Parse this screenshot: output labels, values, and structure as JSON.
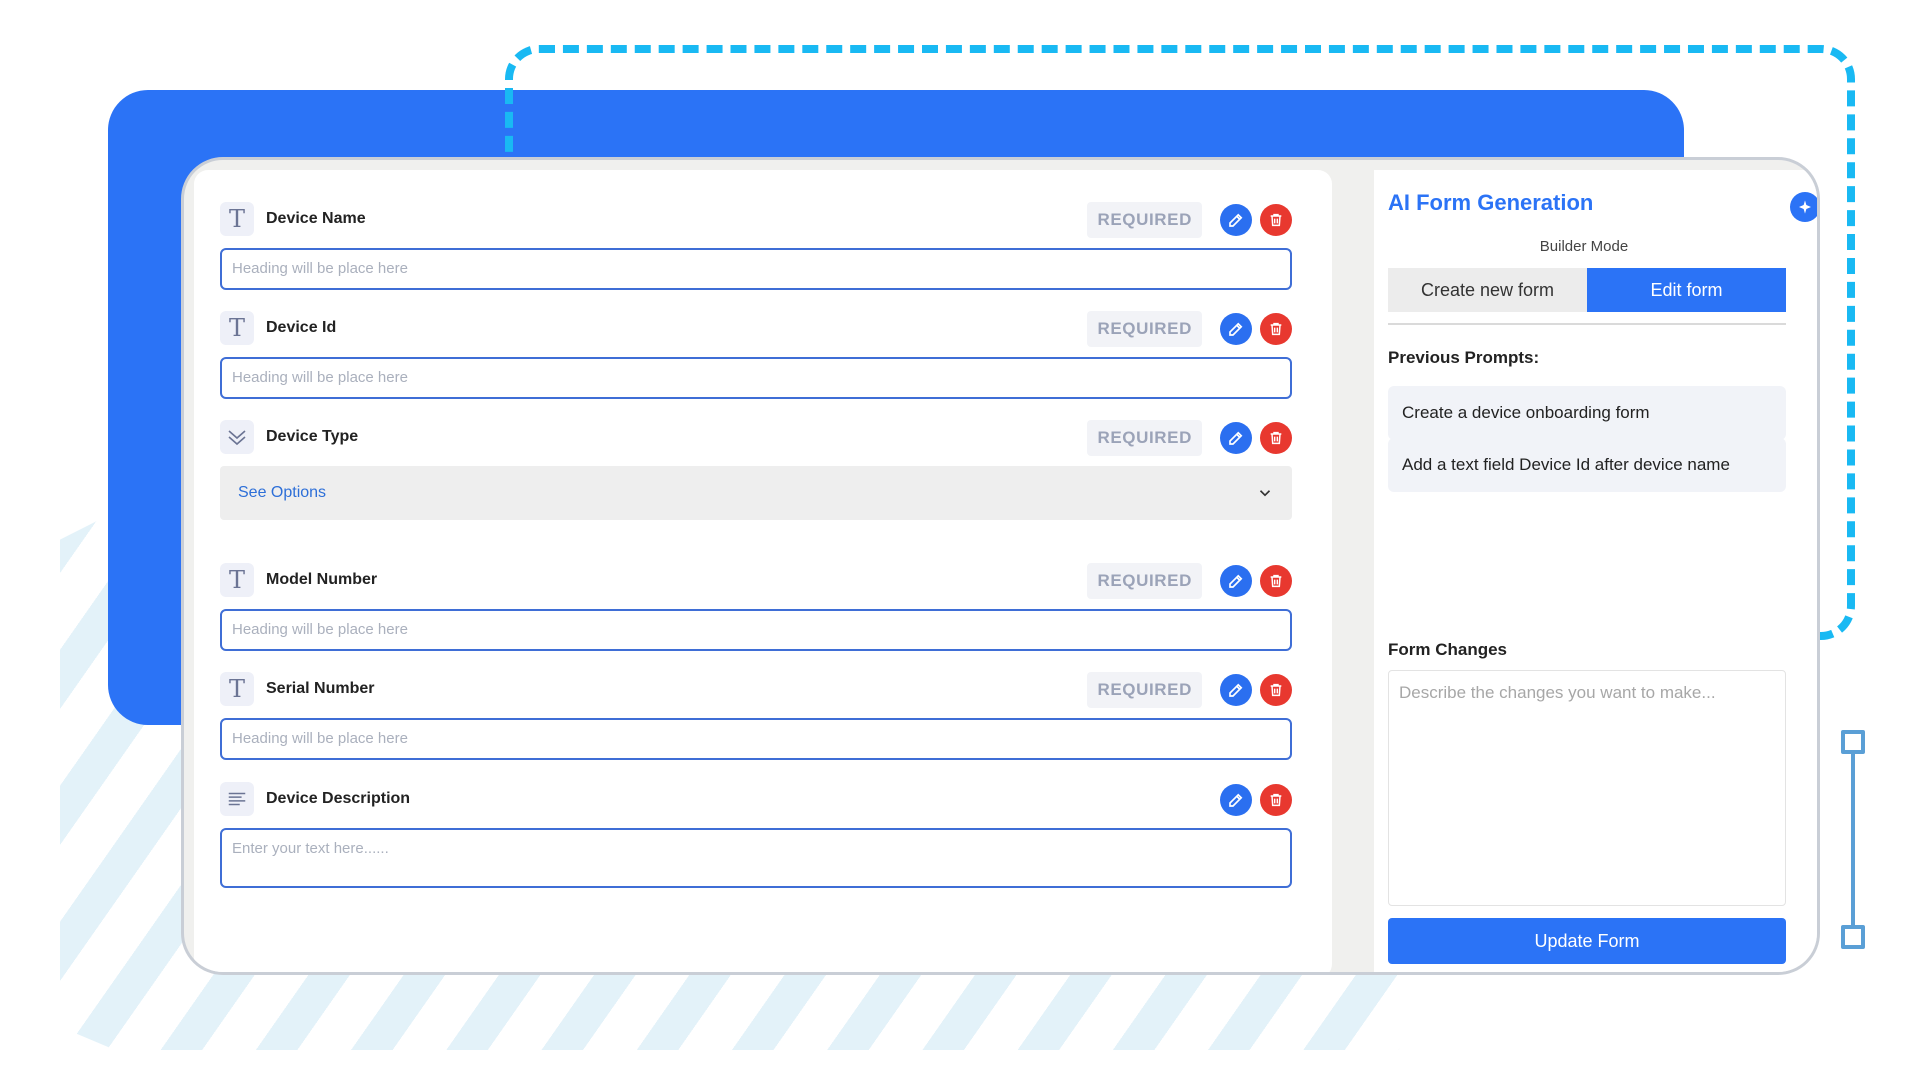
{
  "fields": [
    {
      "label": "Device Name",
      "type_icon": "text-icon",
      "required": "REQUIRED",
      "placeholder": "Heading will be place here"
    },
    {
      "label": "Device Id",
      "type_icon": "text-icon",
      "required": "REQUIRED",
      "placeholder": "Heading will be place here"
    },
    {
      "label": "Device Type",
      "type_icon": "dropdown-icon",
      "required": "REQUIRED",
      "select_text": "See Options"
    },
    {
      "label": "Model Number",
      "type_icon": "text-icon",
      "required": "REQUIRED",
      "placeholder": "Heading will be place here"
    },
    {
      "label": "Serial Number",
      "type_icon": "text-icon",
      "required": "REQUIRED",
      "placeholder": "Heading will be place here"
    },
    {
      "label": "Device Description",
      "type_icon": "paragraph-icon",
      "placeholder": "Enter your text here......"
    }
  ],
  "sidebar": {
    "title": "AI Form Generation",
    "mode_label": "Builder Mode",
    "tabs": [
      "Create new form",
      "Edit form"
    ],
    "active_tab": "Edit form",
    "previous_prompts_title": "Previous Prompts:",
    "previous_prompts": [
      "Create a device onboarding form",
      "Add a text field Device Id after device name"
    ],
    "form_changes_title": "Form Changes",
    "form_changes_placeholder": "Describe the changes you want to make...",
    "update_button": "Update Form"
  },
  "colors": {
    "accent": "#2b73f6",
    "delete": "#e8382f",
    "dashed_frame": "#19b9f3"
  }
}
